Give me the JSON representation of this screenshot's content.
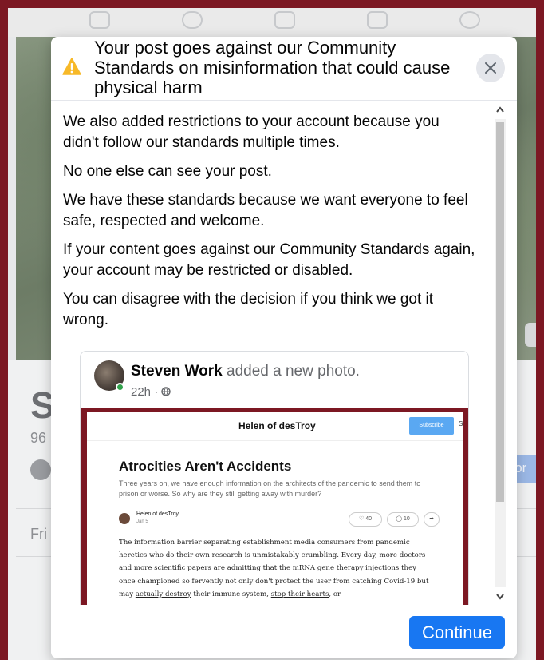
{
  "background": {
    "profile_initial": "S",
    "friend_count_partial": "96",
    "friends_tab_partial": "Fri",
    "story_button_partial": "stor"
  },
  "modal": {
    "title": "Your post goes against our Community Standards on misinformation that could cause physical harm",
    "paragraphs": [
      "We also added restrictions to your account because you didn't follow our standards multiple times.",
      "No one else can see your post.",
      "We have these standards because we want everyone to feel safe, respected and welcome.",
      "If your content goes against our Community Standards again, your account may be restricted or disabled.",
      "You can disagree with the decision if you think we got it wrong."
    ],
    "continue_label": "Continue",
    "warning_color": "#f7b928",
    "accent_color": "#1877f2"
  },
  "post": {
    "author": "Steven Work",
    "action": " added a new photo.",
    "time": "22h · ",
    "privacy_icon": "globe-icon"
  },
  "embedded_article": {
    "site_name": "Helen of desTroy",
    "subscribe_label": "Subscribe",
    "edge_letter": "S",
    "title": "Atrocities Aren't Accidents",
    "subtitle": "Three years on, we have enough information on the architects of the pandemic to send them to prison or worse. So why are they still getting away with murder?",
    "author": "Helen of desTroy",
    "date": "Jan 5",
    "likes": "40",
    "comments": "10",
    "body_1": "The information barrier separating establishment media consumers from pandemic heretics who do their own research is unmistakably crumbling. Every day, more doctors and more scientific papers are admitting that the mRNA gene therapy injections they once championed so fervently not only don't protect the user from catching Covid-19 but may ",
    "link_1": "actually destroy",
    "body_2": " their immune system, ",
    "link_2": "stop their hearts",
    "body_3": ", or"
  }
}
